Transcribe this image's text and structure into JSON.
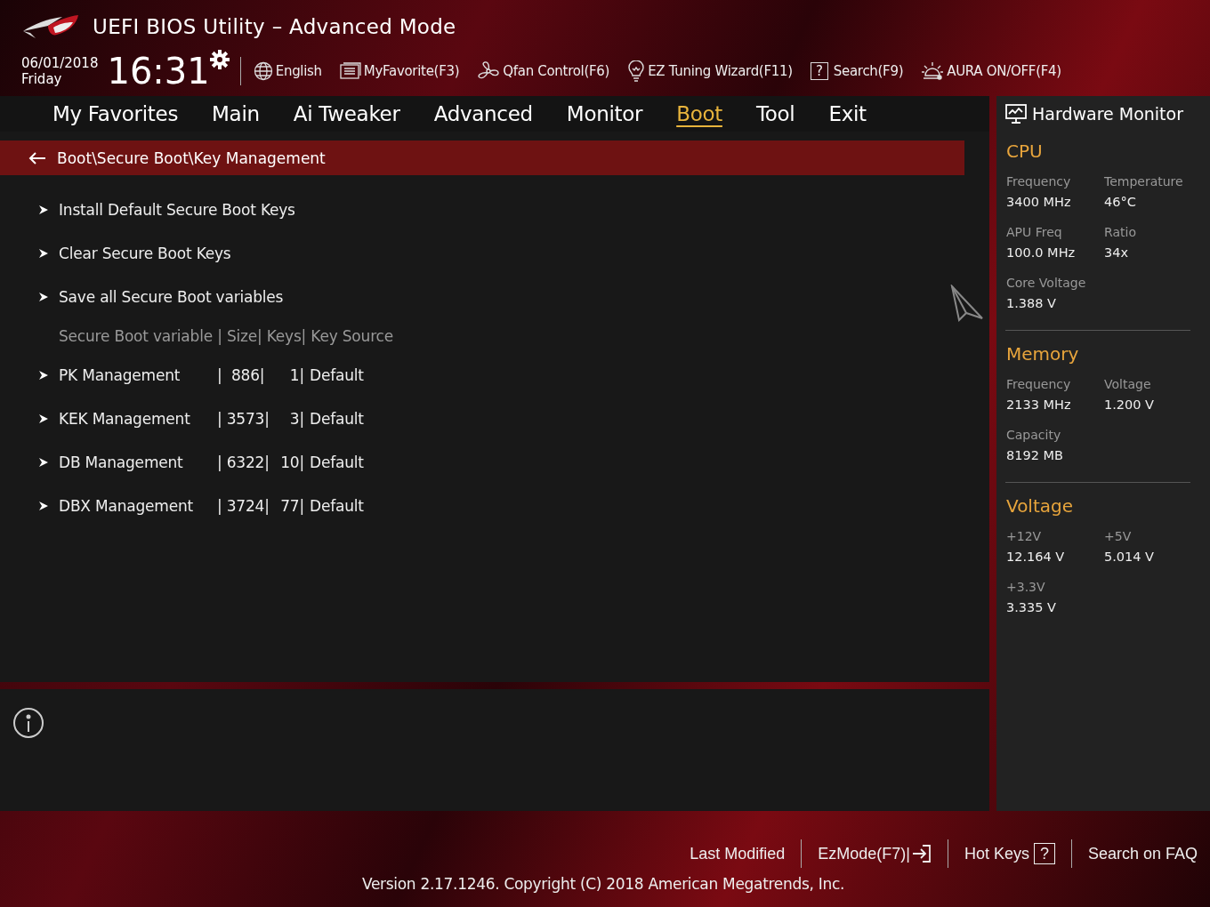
{
  "header": {
    "title": "UEFI BIOS Utility – Advanced Mode",
    "date": "06/01/2018",
    "day": "Friday",
    "time": "16:31",
    "tools": [
      {
        "kind": "globe",
        "label": "English"
      },
      {
        "kind": "list",
        "label": "MyFavorite(F3)"
      },
      {
        "kind": "fan",
        "label": "Qfan Control(F6)"
      },
      {
        "kind": "bulb",
        "label": "EZ Tuning Wizard(F11)"
      },
      {
        "kind": "boxed",
        "glyph": "?",
        "label": "Search(F9)"
      },
      {
        "kind": "aura",
        "label": "AURA ON/OFF(F4)"
      }
    ]
  },
  "tabs": [
    {
      "label": "My Favorites",
      "selected": false
    },
    {
      "label": "Main",
      "selected": false
    },
    {
      "label": "Ai Tweaker",
      "selected": false
    },
    {
      "label": "Advanced",
      "selected": false
    },
    {
      "label": "Monitor",
      "selected": false
    },
    {
      "label": "Boot",
      "selected": true
    },
    {
      "label": "Tool",
      "selected": false
    },
    {
      "label": "Exit",
      "selected": false
    }
  ],
  "breadcrumb": "Boot\\Secure Boot\\Key Management",
  "entries": [
    {
      "kind": "action",
      "label": "Install Default Secure Boot Keys"
    },
    {
      "kind": "action",
      "label": "Clear Secure Boot Keys"
    },
    {
      "kind": "action",
      "label": "Save all Secure Boot variables"
    },
    {
      "kind": "heading",
      "label": "Secure Boot variable | Size| Keys| Key Source"
    },
    {
      "kind": "variable",
      "label": "PK Management",
      "size": "|  886|",
      "keys": "1|",
      "source": "Default"
    },
    {
      "kind": "variable",
      "label": "KEK Management",
      "size": "| 3573|",
      "keys": "3|",
      "source": "Default"
    },
    {
      "kind": "variable",
      "label": "DB Management",
      "size": "| 6322|",
      "keys": "10|",
      "source": "Default"
    },
    {
      "kind": "variable",
      "label": "DBX Management",
      "size": "| 3724|",
      "keys": "77|",
      "source": "Default"
    }
  ],
  "monitor": {
    "title": "Hardware Monitor",
    "sections": [
      {
        "title": "CPU",
        "fields": [
          {
            "label": "Frequency",
            "value": "3400 MHz"
          },
          {
            "label": "Temperature",
            "value": "46°C"
          },
          {
            "label": "APU Freq",
            "value": "100.0 MHz"
          },
          {
            "label": "Ratio",
            "value": "34x"
          },
          {
            "label": "Core Voltage",
            "value": "1.388 V"
          }
        ]
      },
      {
        "title": "Memory",
        "fields": [
          {
            "label": "Frequency",
            "value": "2133 MHz"
          },
          {
            "label": "Voltage",
            "value": "1.200 V"
          },
          {
            "label": "Capacity",
            "value": "8192 MB"
          }
        ]
      },
      {
        "title": "Voltage",
        "fields": [
          {
            "label": "+12V",
            "value": "12.164 V"
          },
          {
            "label": "+5V",
            "value": "5.014 V"
          },
          {
            "label": "+3.3V",
            "value": "3.335 V"
          }
        ]
      }
    ]
  },
  "footer": {
    "links": [
      {
        "kind": "plain",
        "label": "Last Modified"
      },
      {
        "kind": "exit",
        "label": "EzMode(F7)|"
      },
      {
        "kind": "boxed",
        "label": "Hot Keys",
        "glyph": "?"
      },
      {
        "kind": "plain",
        "label": "Search on FAQ"
      }
    ],
    "version": "Version 2.17.1246. Copyright (C) 2018 American Megatrends, Inc."
  }
}
